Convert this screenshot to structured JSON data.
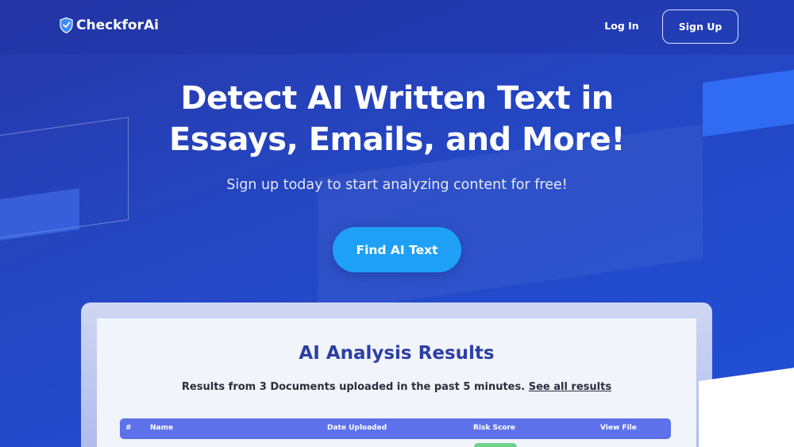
{
  "header": {
    "brand": "CheckforAi",
    "login_label": "Log In",
    "signup_label": "Sign Up"
  },
  "hero": {
    "title_line1": "Detect AI Written Text in",
    "title_line2": "Essays, Emails, and More!",
    "subtitle": "Sign up today to start analyzing content for free!",
    "cta_label": "Find AI Text"
  },
  "results": {
    "title": "AI Analysis Results",
    "description": "Results from 3 Documents uploaded in the past 5 minutes.",
    "link_label": "See all results",
    "columns": [
      "#",
      "Name",
      "Date Uploaded",
      "Risk Score",
      "View File"
    ]
  },
  "colors": {
    "background": "#2447c4",
    "cta": "#1ea0f7",
    "table_header": "#5d72ea",
    "results_title": "#2c3fa4",
    "risk_low": "#6fd08a"
  },
  "icons": {
    "logo": "shield-icon"
  }
}
